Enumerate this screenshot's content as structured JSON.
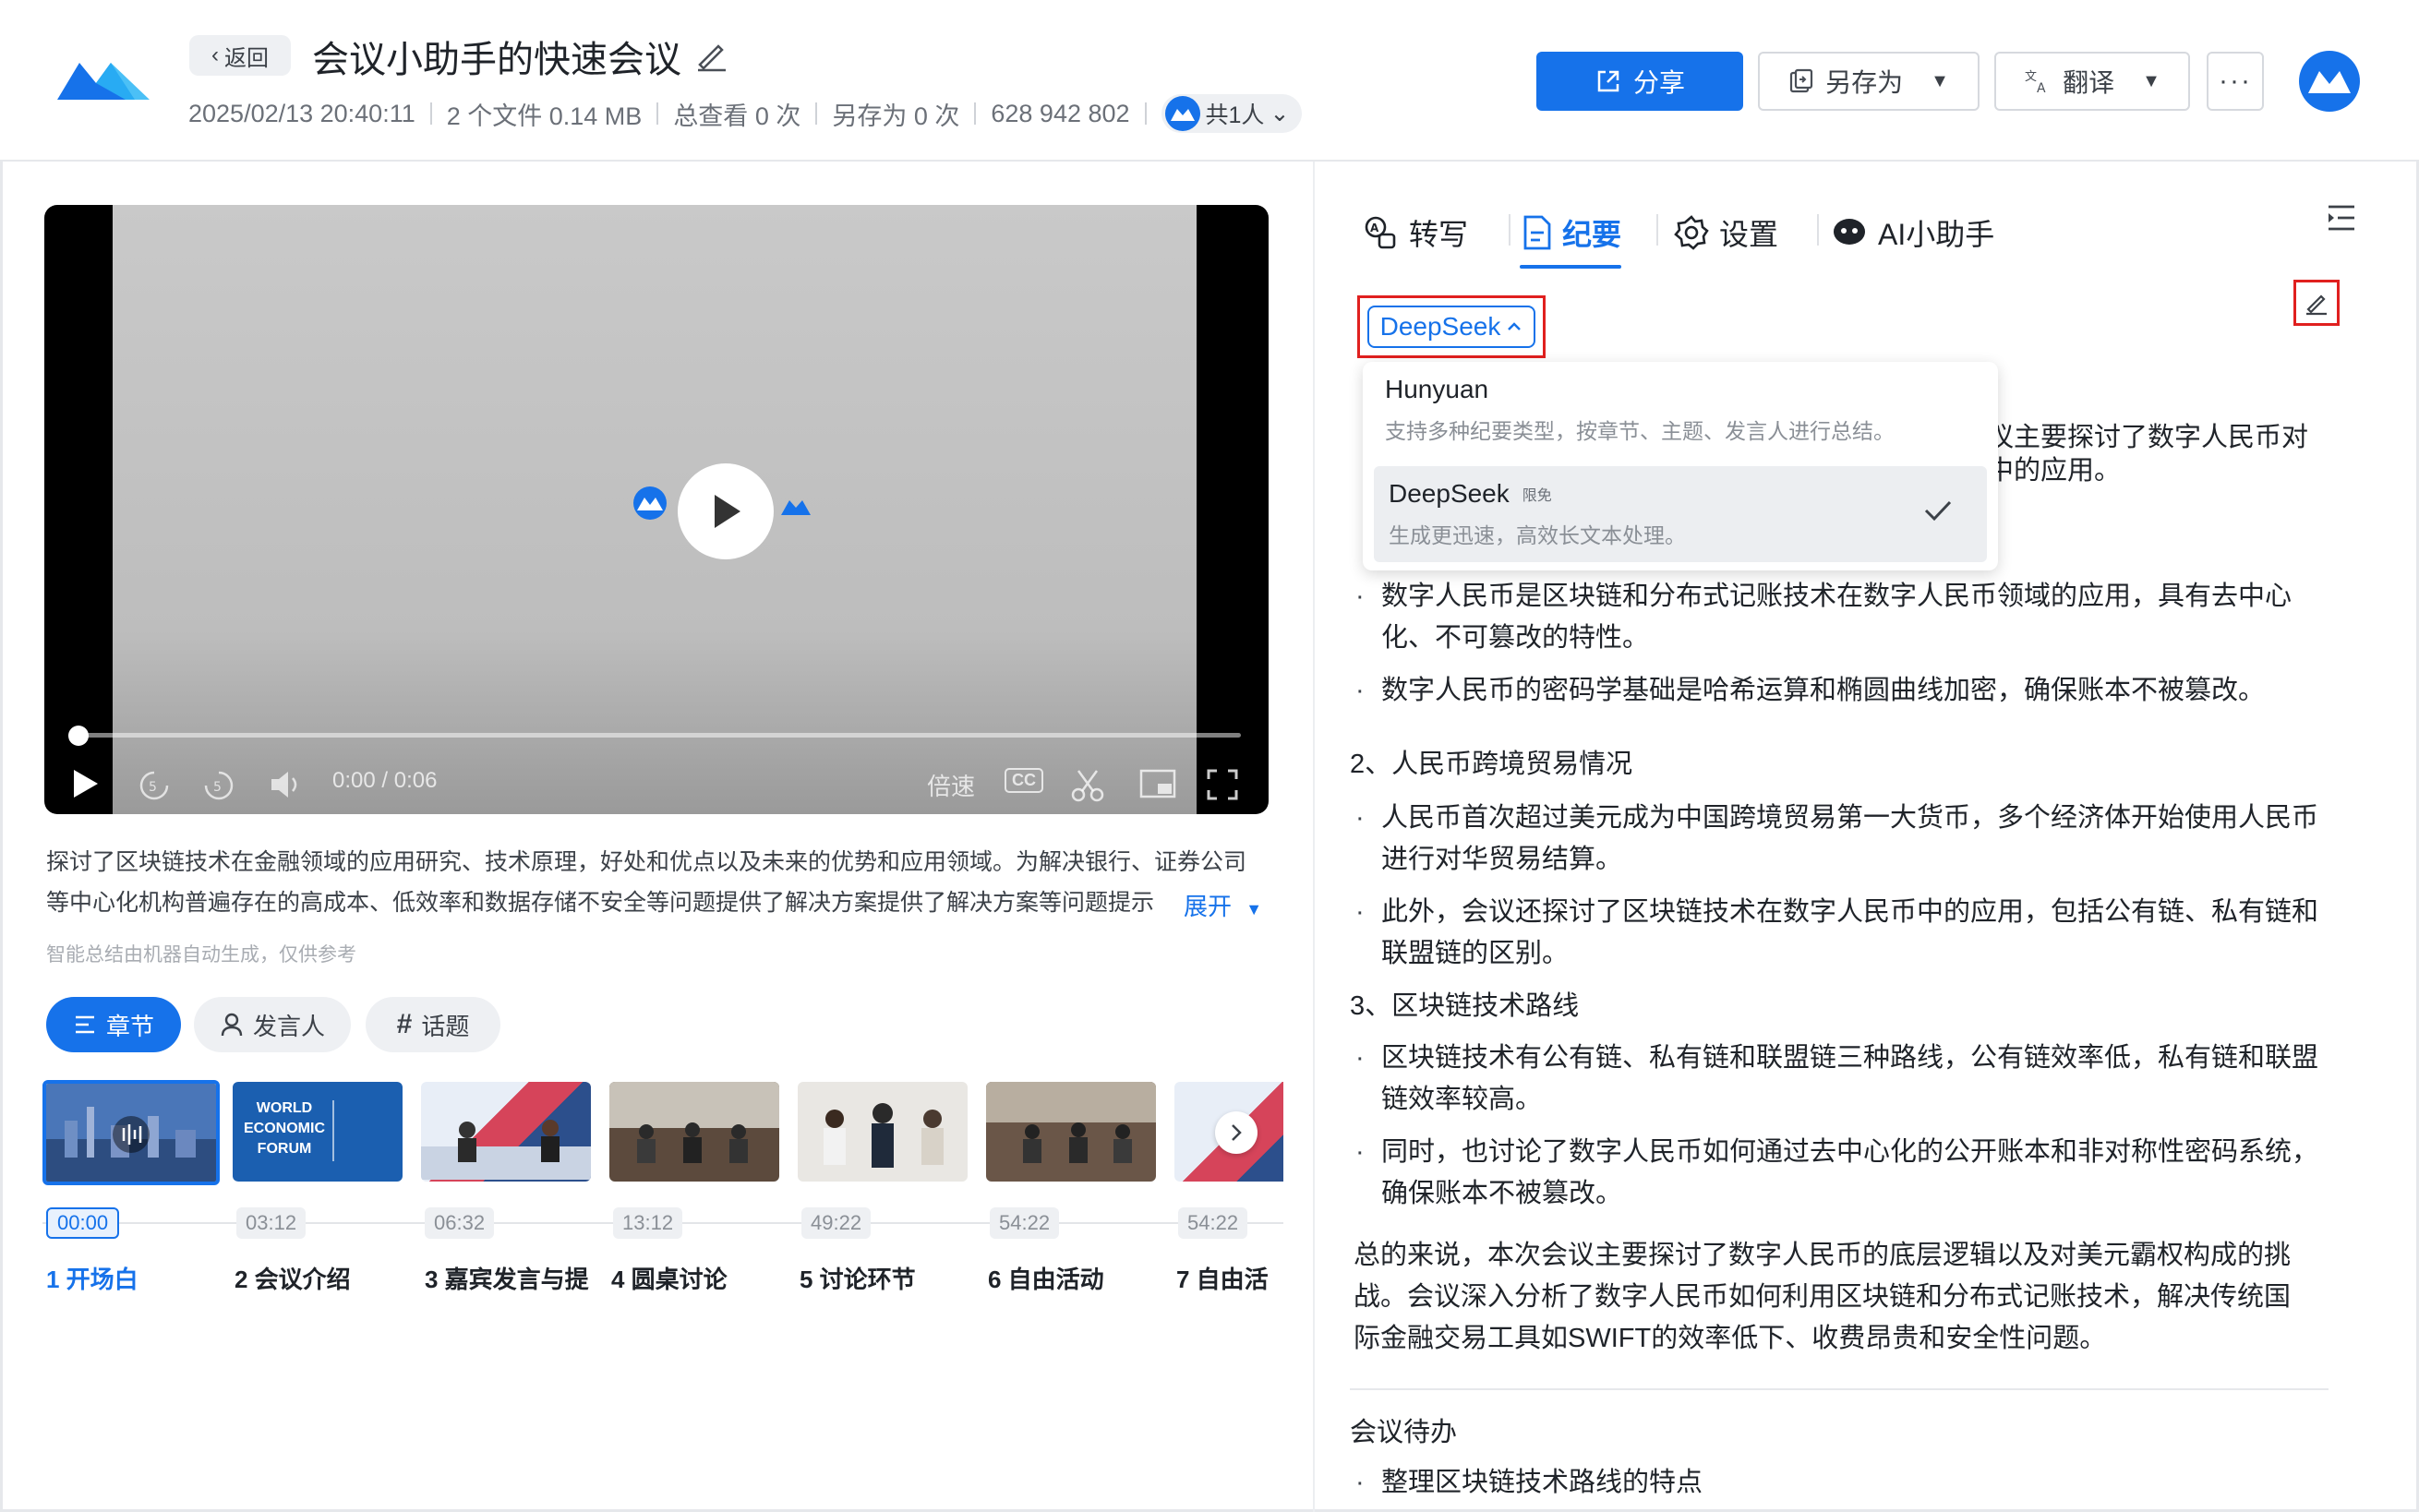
{
  "header": {
    "back_label": "返回",
    "title": "会议小助手的快速会议",
    "meta": {
      "datetime": "2025/02/13 20:40:11",
      "files": "2 个文件 0.14 MB",
      "views": "总查看 0 次",
      "saved": "另存为 0 次",
      "meeting_id": "628 942 802",
      "participants": "共1人"
    },
    "share_label": "分享",
    "saveas_label": "另存为",
    "translate_label": "翻译",
    "more_label": "···"
  },
  "player": {
    "time": "0:00 / 0:06",
    "speed_label": "倍速",
    "cc_label": "CC",
    "progress": 0
  },
  "summary": {
    "text": "探讨了区块链技术在金融领域的应用研究、技术原理，好处和优点以及未来的优势和应用领域。为解决银行、证券公司等中心化机构普遍存在的高成本、低效率和数据存储不安全等问题提供了解决方案提供了解决方案等问题提示",
    "expand_label": "展开",
    "note": "智能总结由机器自动生成，仅供参考"
  },
  "filters": {
    "chapter": "章节",
    "speaker": "发言人",
    "topic": "话题"
  },
  "chapters": [
    {
      "time": "00:00",
      "label": "1 开场白"
    },
    {
      "time": "03:12",
      "label": "2 会议介绍"
    },
    {
      "time": "06:32",
      "label": "3 嘉宾发言与提"
    },
    {
      "time": "13:12",
      "label": "4 圆桌讨论"
    },
    {
      "time": "49:22",
      "label": "5 讨论环节"
    },
    {
      "time": "54:22",
      "label": "6 自由活动"
    },
    {
      "time": "54:22",
      "label": "7 自由活"
    }
  ],
  "thumb_text": {
    "line1": "WORLD",
    "line2": "ECONOMIC",
    "line3": "FORUM"
  },
  "tabs": [
    {
      "label": "转写"
    },
    {
      "label": "纪要"
    },
    {
      "label": "设置"
    },
    {
      "label": "AI小助手"
    }
  ],
  "model": {
    "current": "DeepSeek",
    "options": [
      {
        "name": "Hunyuan",
        "tag": "",
        "desc": "支持多种纪要类型，按章节、主题、发言人进行总结。"
      },
      {
        "name": "DeepSeek",
        "tag": "限免",
        "desc": "生成更迅速，高效长文本处理。"
      }
    ]
  },
  "minutes": {
    "partial_1": "议主要探讨了数字人民币对",
    "partial_2": "中的应用。",
    "bullets_1": [
      "数字人民币是区块链和分布式记账技术在数字人民币领域的应用，具有去中心化、不可篡改的特性。",
      "数字人民币的密码学基础是哈希运算和椭圆曲线加密，确保账本不被篡改。"
    ],
    "section_2": "2、人民币跨境贸易情况",
    "bullets_2": [
      "人民币首次超过美元成为中国跨境贸易第一大货币，多个经济体开始使用人民币进行对华贸易结算。",
      "此外，会议还探讨了区块链技术在数字人民币中的应用，包括公有链、私有链和联盟链的区别。"
    ],
    "section_3": "3、区块链技术路线",
    "bullets_3": [
      "区块链技术有公有链、私有链和联盟链三种路线，公有链效率低，私有链和联盟链效率较高。",
      "同时，也讨论了数字人民币如何通过去中心化的公开账本和非对称性密码系统，确保账本不被篡改。"
    ],
    "conclusion": "总的来说，本次会议主要探讨了数字人民币的底层逻辑以及对美元霸权构成的挑战。会议深入分析了数字人民币如何利用区块链和分布式记账技术，解决传统国际金融交易工具如SWIFT的效率低下、收费昂贵和安全性问题。",
    "todo_title": "会议待办",
    "todo_1": "整理区块链技术路线的特点"
  },
  "colors": {
    "accent": "#1672ea",
    "highlight_box": "#e0201f"
  }
}
